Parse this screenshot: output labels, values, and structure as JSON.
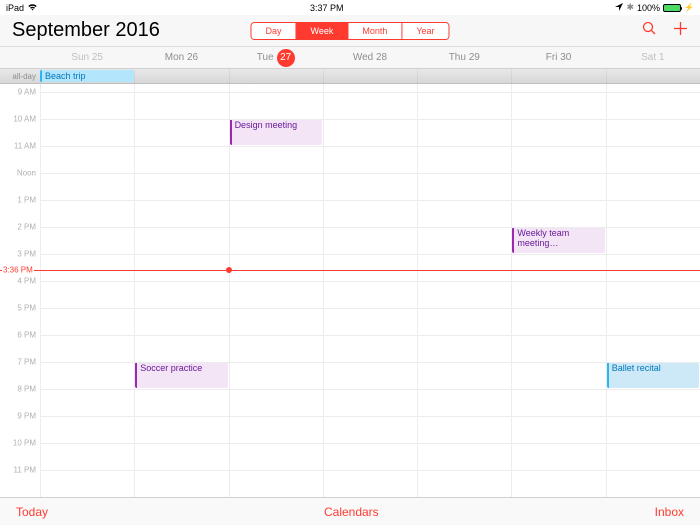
{
  "status": {
    "device": "iPad",
    "time": "3:37 PM",
    "battery_pct": "100%"
  },
  "header": {
    "month": "September",
    "year": "2016",
    "views": [
      "Day",
      "Week",
      "Month",
      "Year"
    ],
    "active_view": "Week"
  },
  "days": [
    {
      "label": "Sun 25",
      "weekend": true,
      "today": false
    },
    {
      "label": "Mon 26",
      "weekend": false,
      "today": false
    },
    {
      "label": "Tue",
      "num": "27",
      "weekend": false,
      "today": true
    },
    {
      "label": "Wed 28",
      "weekend": false,
      "today": false
    },
    {
      "label": "Thu 29",
      "weekend": false,
      "today": false
    },
    {
      "label": "Fri 30",
      "weekend": false,
      "today": false
    },
    {
      "label": "Sat 1",
      "weekend": true,
      "today": false
    }
  ],
  "allday": {
    "label": "all-day",
    "events": [
      {
        "title": "Beach trip",
        "day": 0,
        "color": "blue"
      }
    ]
  },
  "hours": [
    "9 AM",
    "10 AM",
    "11 AM",
    "Noon",
    "1 PM",
    "2 PM",
    "3 PM",
    "4 PM",
    "5 PM",
    "6 PM",
    "7 PM",
    "8 PM",
    "9 PM",
    "10 PM",
    "11 PM"
  ],
  "now": {
    "label": "3:36 PM",
    "hour_offset": 6.6,
    "day": 2
  },
  "events": [
    {
      "title": "Design meeting",
      "day": 2,
      "start": 1.0,
      "dur": 1.0,
      "color": "purple"
    },
    {
      "title": "Weekly team meeting…",
      "day": 5,
      "start": 5.0,
      "dur": 1.0,
      "color": "purple"
    },
    {
      "title": "Soccer practice",
      "day": 1,
      "start": 10.0,
      "dur": 1.0,
      "color": "purple"
    },
    {
      "title": "Ballet recital",
      "day": 6,
      "start": 10.0,
      "dur": 1.0,
      "color": "blue"
    }
  ],
  "toolbar": {
    "today": "Today",
    "calendars": "Calendars",
    "inbox": "Inbox"
  }
}
